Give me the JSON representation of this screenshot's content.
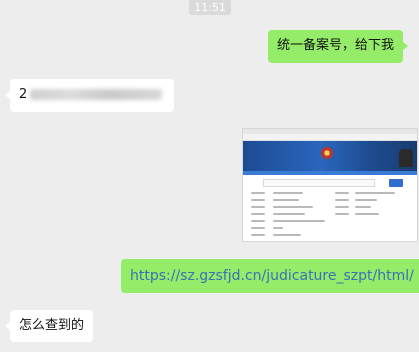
{
  "status_bar": {
    "time": "11:51"
  },
  "messages": {
    "m1": {
      "sender": "self",
      "text": "统一备案号，给下我"
    },
    "m2": {
      "sender": "other",
      "text": "2"
    },
    "m3": {
      "sender": "self",
      "type": "image"
    },
    "m4": {
      "sender": "self",
      "text": "https://sz.gzsfjd.cn/judicature_szpt/html/"
    },
    "m5": {
      "sender": "other",
      "text": "怎么查到的"
    }
  },
  "colors": {
    "chat_background": "#ededed",
    "outgoing_bubble": "#95ec69",
    "incoming_bubble": "#ffffff",
    "link": "#3b6fb6"
  }
}
